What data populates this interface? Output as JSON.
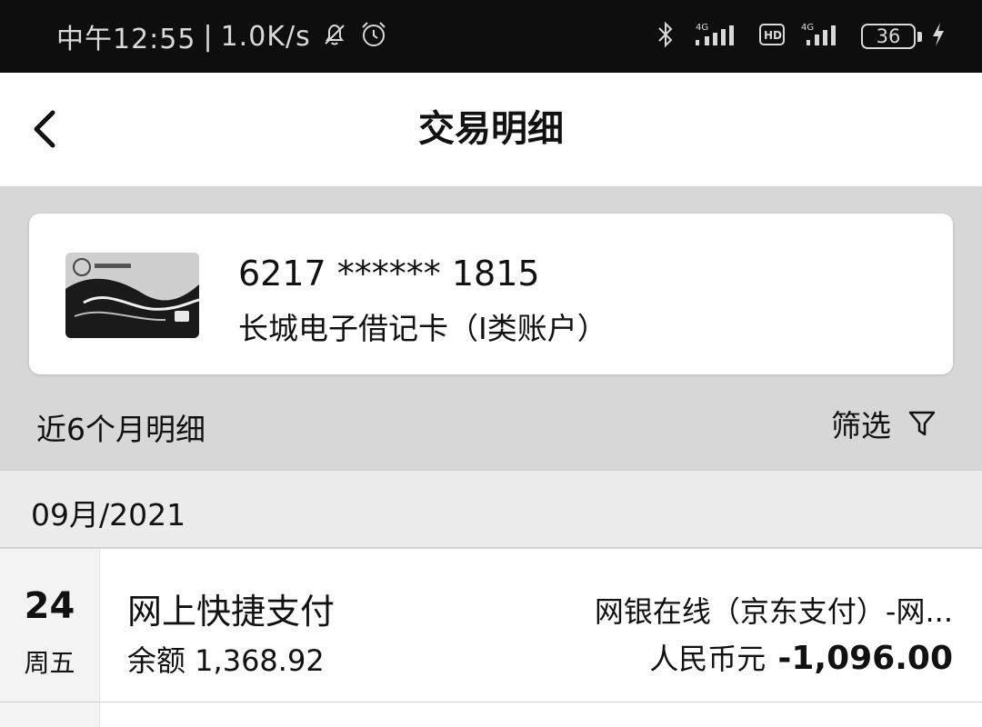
{
  "status_bar": {
    "time": "中午12:55",
    "network_speed": "1.0K/s",
    "battery_level": "36",
    "icons": [
      "bell-off-icon",
      "alarm-icon",
      "bluetooth-icon",
      "signal-4g-icon",
      "hd-icon",
      "signal-4g-icon",
      "battery-icon",
      "charging-icon"
    ]
  },
  "header": {
    "title": "交易明细",
    "back_icon": "chevron-left-icon"
  },
  "card": {
    "number": "6217 ****** 1815",
    "name": "长城电子借记卡（Ⅰ类账户）"
  },
  "period": {
    "label": "近6个月明细",
    "filter_label": "筛选",
    "filter_icon": "funnel-icon"
  },
  "month": {
    "label": "09月/2021"
  },
  "transactions": [
    {
      "day": "24",
      "weekday": "周五",
      "type": "网上快捷支付",
      "balance": "余额 1,368.92",
      "merchant": "网银在线（京东支付）-网...",
      "currency": "人民币元",
      "amount": "-1,096.00"
    }
  ],
  "colors": {
    "status_bar_bg": "#0e0e0e",
    "page_bg": "#d7d7d7",
    "panel_bg": "#ffffff",
    "month_header_bg": "#ececec"
  }
}
